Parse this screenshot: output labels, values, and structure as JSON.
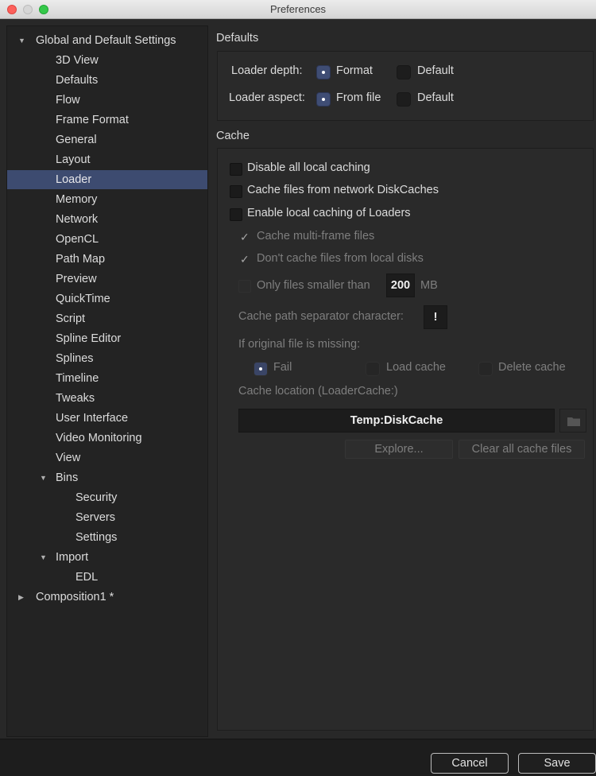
{
  "window": {
    "title": "Preferences"
  },
  "sidebar": {
    "items": [
      {
        "label": "Global and Default Settings",
        "expanded": true
      },
      {
        "label": "3D View"
      },
      {
        "label": "Defaults"
      },
      {
        "label": "Flow"
      },
      {
        "label": "Frame Format"
      },
      {
        "label": "General"
      },
      {
        "label": "Layout"
      },
      {
        "label": "Loader",
        "selected": true
      },
      {
        "label": "Memory"
      },
      {
        "label": "Network"
      },
      {
        "label": "OpenCL"
      },
      {
        "label": "Path Map"
      },
      {
        "label": "Preview"
      },
      {
        "label": "QuickTime"
      },
      {
        "label": "Script"
      },
      {
        "label": "Spline Editor"
      },
      {
        "label": "Splines"
      },
      {
        "label": "Timeline"
      },
      {
        "label": "Tweaks"
      },
      {
        "label": "User Interface"
      },
      {
        "label": "Video Monitoring"
      },
      {
        "label": "View"
      },
      {
        "label": "Bins",
        "expanded": true
      },
      {
        "label": "Security"
      },
      {
        "label": "Servers"
      },
      {
        "label": "Settings"
      },
      {
        "label": "Import",
        "expanded": true
      },
      {
        "label": "EDL"
      },
      {
        "label": "Composition1 *",
        "expanded": false
      }
    ]
  },
  "defaults": {
    "heading": "Defaults",
    "loader_depth": {
      "label": "Loader depth:",
      "options": [
        "Format",
        "Default"
      ],
      "selected": "Format"
    },
    "loader_aspect": {
      "label": "Loader aspect:",
      "options": [
        "From file",
        "Default"
      ],
      "selected": "From file"
    }
  },
  "cache": {
    "heading": "Cache",
    "disable_local": {
      "label": "Disable all local caching",
      "checked": false
    },
    "network_diskcaches": {
      "label": "Cache files from network DiskCaches",
      "checked": false
    },
    "enable_loaders": {
      "label": "Enable local caching of Loaders",
      "checked": false
    },
    "multi_frame": {
      "label": "Cache multi-frame files",
      "checked": true
    },
    "no_local_disks": {
      "label": "Don't cache files from local disks",
      "checked": true
    },
    "only_smaller": {
      "label": "Only files smaller than",
      "checked": false,
      "value": "200",
      "unit": "MB"
    },
    "separator": {
      "label": "Cache path separator character:",
      "value": "!"
    },
    "missing": {
      "label": "If original file is missing:",
      "options": [
        "Fail",
        "Load cache",
        "Delete cache"
      ],
      "selected": "Fail"
    },
    "location": {
      "label": "Cache location (LoaderCache:)",
      "value": "Temp:DiskCache"
    },
    "explore_label": "Explore...",
    "clear_label": "Clear all cache files"
  },
  "footer": {
    "cancel_label": "Cancel",
    "save_label": "Save"
  }
}
